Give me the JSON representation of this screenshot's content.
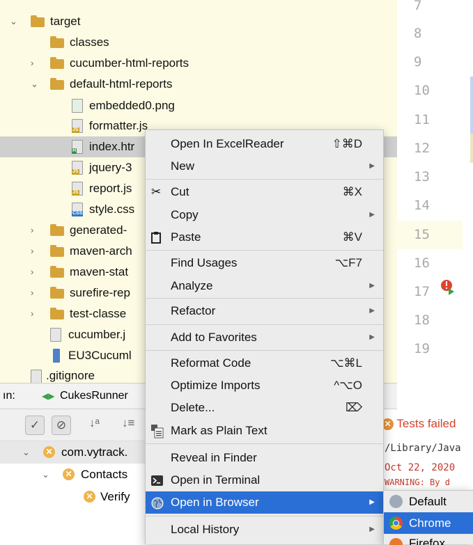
{
  "tree": {
    "items": [
      {
        "label": "target",
        "kind": "folder",
        "expanded": true
      },
      {
        "label": "classes",
        "kind": "folder"
      },
      {
        "label": "cucumber-html-reports",
        "kind": "folder",
        "expanded": false
      },
      {
        "label": "default-html-reports",
        "kind": "folder",
        "expanded": true
      },
      {
        "label": "embedded0.png",
        "kind": "file"
      },
      {
        "label": "formatter.js",
        "kind": "file",
        "badge": "JS"
      },
      {
        "label": "index.htr",
        "kind": "file",
        "badge": "H",
        "selected": true
      },
      {
        "label": "jquery-3",
        "kind": "file",
        "badge": "JS"
      },
      {
        "label": "report.js",
        "kind": "file",
        "badge": "JS"
      },
      {
        "label": "style.css",
        "kind": "file",
        "badge": "CSS"
      },
      {
        "label": "generated-",
        "kind": "folder",
        "expanded": false
      },
      {
        "label": "maven-arch",
        "kind": "folder",
        "expanded": false
      },
      {
        "label": "maven-stat",
        "kind": "folder",
        "expanded": false
      },
      {
        "label": "surefire-rep",
        "kind": "folder",
        "expanded": false
      },
      {
        "label": "test-classe",
        "kind": "folder",
        "expanded": false
      },
      {
        "label": "cucumber.j",
        "kind": "file"
      },
      {
        "label": "EU3Cucuml",
        "kind": "file"
      },
      {
        "label": ".gitignore",
        "kind": "file"
      }
    ]
  },
  "gutter": {
    "lines": [
      "7",
      "8",
      "9",
      "10",
      "11",
      "12",
      "13",
      "14",
      "15",
      "16",
      "17",
      "18",
      "19"
    ]
  },
  "run_panel": {
    "prefix": "ın:",
    "tab_label": "CukesRunner"
  },
  "results": {
    "rows": [
      "com.vytrack.",
      "Contacts",
      "Verify"
    ]
  },
  "console": {
    "status": "Tests failed",
    "lines": [
      "/Library/Java",
      "Oct 22, 2020",
      "WARNING: By d"
    ]
  },
  "context_menu": {
    "items": [
      {
        "label": "Open In ExcelReader",
        "shortcut": "⇧⌘D"
      },
      {
        "label": "New",
        "submenu": true
      },
      {
        "label": "Cut",
        "shortcut": "⌘X",
        "icon": "scissors-icon"
      },
      {
        "label": "Copy",
        "submenu": true
      },
      {
        "label": "Paste",
        "shortcut": "⌘V",
        "icon": "clipboard-icon"
      },
      {
        "label": "Find Usages",
        "shortcut": "⌥F7"
      },
      {
        "label": "Analyze",
        "submenu": true
      },
      {
        "label": "Refactor",
        "submenu": true
      },
      {
        "label": "Add to Favorites",
        "submenu": true
      },
      {
        "label": "Reformat Code",
        "shortcut": "⌥⌘L"
      },
      {
        "label": "Optimize Imports",
        "shortcut": "^⌥O"
      },
      {
        "label": "Delete...",
        "shortcut": "⌦"
      },
      {
        "label": "Mark as Plain Text",
        "icon": "plain-text-icon"
      },
      {
        "label": "Reveal in Finder"
      },
      {
        "label": "Open in Terminal",
        "icon": "terminal-icon"
      },
      {
        "label": "Open in Browser",
        "submenu": true,
        "icon": "globe-icon",
        "highlighted": true
      },
      {
        "label": "Local History",
        "submenu": true
      }
    ]
  },
  "browser_submenu": {
    "items": [
      {
        "label": "Default"
      },
      {
        "label": "Chrome",
        "highlighted": true
      },
      {
        "label": "Firefox"
      }
    ]
  },
  "colors": {
    "tree_bg": "#fdfbe3",
    "folder": "#d6a33b",
    "selection": "#2a6fd6",
    "error": "#e0442d"
  }
}
